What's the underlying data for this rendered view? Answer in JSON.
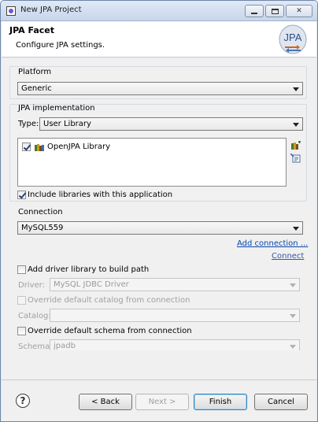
{
  "window": {
    "title": "New JPA Project"
  },
  "header": {
    "title": "JPA Facet",
    "description": "Configure JPA settings."
  },
  "platform": {
    "label": "Platform",
    "value": "Generic"
  },
  "jpa_implementation": {
    "label": "JPA implementation",
    "type_label": "Type:",
    "type_value": "User Library",
    "libraries": [
      {
        "name": "OpenJPA Library",
        "checked": true
      }
    ],
    "include_libraries_label": "Include libraries with this application",
    "include_libraries_checked": true
  },
  "connection": {
    "label": "Connection",
    "value": "MySQL559",
    "add_connection_link": "Add connection ...",
    "connect_link": "Connect",
    "add_driver_label": "Add driver library to build path",
    "driver_label": "Driver:",
    "driver_value": "MySQL JDBC Driver",
    "override_catalog_label": "Override default catalog from connection",
    "catalog_label": "Catalog:",
    "catalog_value": "",
    "override_schema_label": "Override default schema from connection",
    "schema_label": "Schema:",
    "schema_value": "jpadb"
  },
  "footer": {
    "help": "?",
    "back": "< Back",
    "next": "Next >",
    "finish": "Finish",
    "cancel": "Cancel"
  },
  "icons": {
    "app": "eclipse-icon",
    "logo": "jpa-logo-icon",
    "library": "library-icon",
    "add_library": "add-library-icon",
    "download_library": "download-library-icon"
  }
}
